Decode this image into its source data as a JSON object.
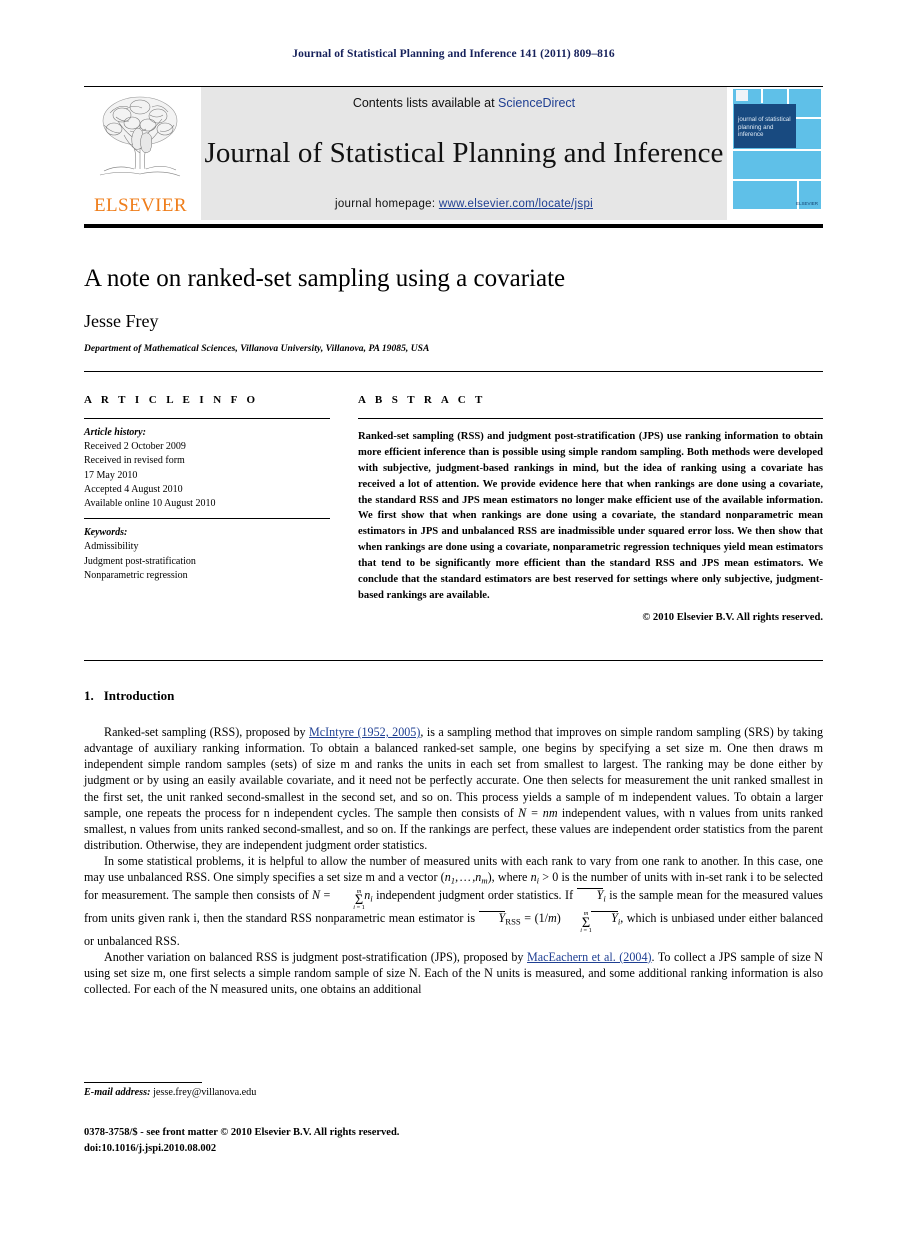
{
  "running_head": "Journal of Statistical Planning and Inference 141 (2011) 809–816",
  "masthead": {
    "publisher_wordmark": "ELSEVIER",
    "contents_prefix": "Contents lists available at",
    "contents_link": "ScienceDirect",
    "journal_title": "Journal of Statistical Planning and Inference",
    "homepage_prefix": "journal homepage:",
    "homepage_url": "www.elsevier.com/locate/jspi",
    "cover_title_lines": "journal of statistical planning and inference",
    "cover_publisher": "ELSEVIER"
  },
  "article": {
    "title": "A note on ranked-set sampling using a covariate",
    "author": "Jesse Frey",
    "affiliation": "Department of Mathematical Sciences, Villanova University, Villanova, PA 19085, USA"
  },
  "info": {
    "heading": "A R T I C L E   I N F O",
    "history_label": "Article history:",
    "history": [
      "Received 2 October 2009",
      "Received in revised form",
      "17 May 2010",
      "Accepted 4 August 2010",
      "Available online 10 August 2010"
    ],
    "keywords_label": "Keywords:",
    "keywords": [
      "Admissibility",
      "Judgment post-stratification",
      "Nonparametric regression"
    ]
  },
  "abstract": {
    "heading": "A B S T R A C T",
    "text": "Ranked-set sampling (RSS) and judgment post-stratification (JPS) use ranking information to obtain more efficient inference than is possible using simple random sampling. Both methods were developed with subjective, judgment-based rankings in mind, but the idea of ranking using a covariate has received a lot of attention. We provide evidence here that when rankings are done using a covariate, the standard RSS and JPS mean estimators no longer make efficient use of the available information. We first show that when rankings are done using a covariate, the standard nonparametric mean estimators in JPS and unbalanced RSS are inadmissible under squared error loss. We then show that when rankings are done using a covariate, nonparametric regression techniques yield mean estimators that tend to be significantly more efficient than the standard RSS and JPS mean estimators. We conclude that the standard estimators are best reserved for settings where only subjective, judgment-based rankings are available.",
    "copyright": "© 2010 Elsevier B.V. All rights reserved."
  },
  "body": {
    "section_number": "1.",
    "section_title": "Introduction",
    "para1_a": "Ranked-set sampling (RSS), proposed by ",
    "para1_link": "McIntyre (1952, 2005)",
    "para1_b": ", is a sampling method that improves on simple random sampling (SRS) by taking advantage of auxiliary ranking information. To obtain a balanced ranked-set sample, one begins by specifying a set size m. One then draws m independent simple random samples (sets) of size m and ranks the units in each set from smallest to largest. The ranking may be done either by judgment or by using an easily available covariate, and it need not be perfectly accurate. One then selects for measurement the unit ranked smallest in the first set, the unit ranked second-smallest in the second set, and so on. This process yields a sample of m independent values. To obtain a larger sample, one repeats the process for n independent cycles. The sample then consists of ",
    "para1_math": "N = nm",
    "para1_c": " independent values, with n values from units ranked smallest, n values from units ranked second-smallest, and so on. If the rankings are perfect, these values are independent order statistics from the parent distribution. Otherwise, they are independent judgment order statistics.",
    "para2_a": "In some statistical problems, it is helpful to allow the number of measured units with each rank to vary from one rank to another. In this case, one may use unbalanced RSS. One simply specifies a set size m and a vector ",
    "para2_vec": "(n1,…,nm)",
    "para2_b": ", where ",
    "para2_ni": "ni > 0",
    "para2_c": " is the number of units with in-set rank i to be selected for measurement. The sample then consists of ",
    "para2_sum": "N = Σ i=1 m ni",
    "para2_d": " independent judgment order statistics. If ",
    "para2_ybar": "Ȳi",
    "para2_e": " is the sample mean for the measured values from units given rank i, then the standard RSS nonparametric mean estimator is ",
    "para2_est": "ȲRSS = (1/m) Σ i=1 m Ȳi",
    "para2_f": ", which is unbiased under either balanced or unbalanced RSS.",
    "para3_a": "Another variation on balanced RSS is judgment post-stratification (JPS), proposed by ",
    "para3_link": "MacEachern et al. (2004)",
    "para3_b": ". To collect a JPS sample of size N using set size m, one first selects a simple random sample of size N. Each of the N units is measured, and some additional ranking information is also collected. For each of the N measured units, one obtains an additional"
  },
  "footer": {
    "email_label": "E-mail address:",
    "email": "jesse.frey@villanova.edu",
    "issn_line": "0378-3758/$ - see front matter © 2010 Elsevier B.V. All rights reserved.",
    "doi_line": "doi:10.1016/j.jspi.2010.08.002"
  },
  "colors": {
    "running_head_blue": "#16215b",
    "link_blue": "#1f3f92",
    "elsevier_orange": "#ef7d1a",
    "cover_blue": "#5fc0e8",
    "cover_dark_blue": "#184a80",
    "masthead_grey": "#e6e6e6"
  }
}
